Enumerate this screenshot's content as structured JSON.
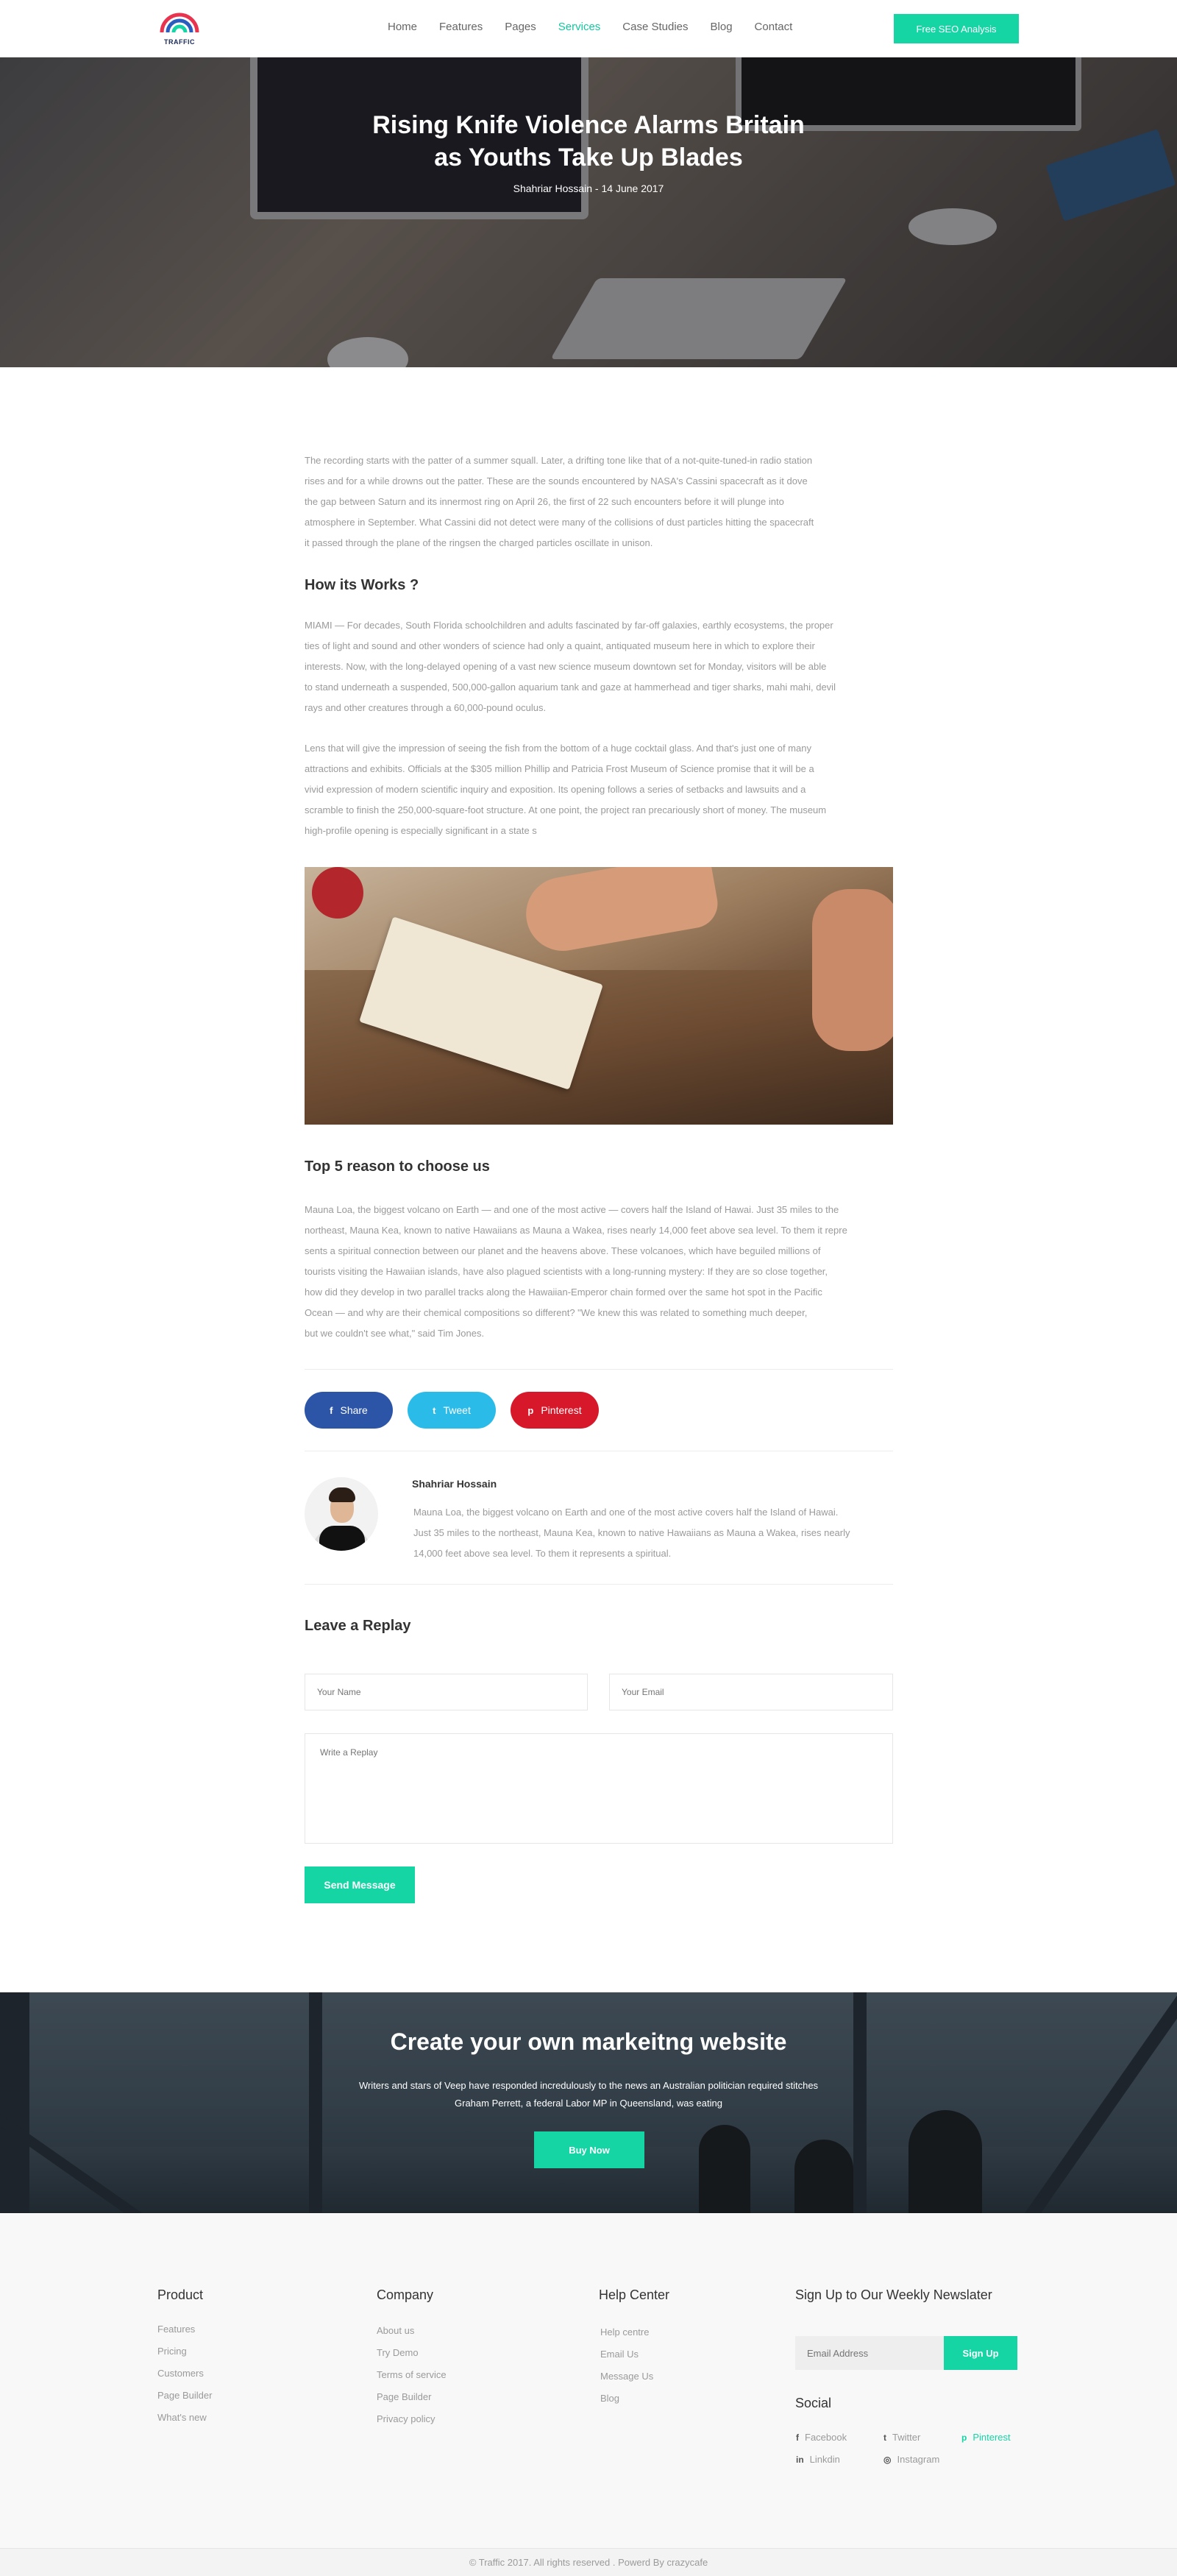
{
  "header": {
    "logo_text": "TRAFFIC",
    "nav": [
      "Home",
      "Features",
      "Pages",
      "Services",
      "Case Studies",
      "Blog",
      "Contact"
    ],
    "active_nav": "Services",
    "cta": "Free SEO Analysis"
  },
  "hero": {
    "title_line1": "Rising Knife Violence Alarms Britain",
    "title_line2": "as Youths Take Up Blades",
    "meta": "Shahriar Hossain - 14 June 2017"
  },
  "article": {
    "intro": [
      "The recording starts with the patter of a summer squall. Later, a drifting tone like that of a not-quite-tuned-in radio station",
      "rises and for a while drowns out the patter. These are the sounds encountered by NASA's Cassini spacecraft as it dove",
      " the gap between Saturn and its innermost ring on April 26, the first of 22 such encounters before it will plunge into",
      "atmosphere in September. What Cassini did not detect were many of the collisions of dust particles hitting the spacecraft",
      "it passed through the plane of the ringsen the charged particles oscillate in unison."
    ],
    "heading1": "How its Works ?",
    "para2": [
      "MIAMI — For decades, South Florida schoolchildren and adults fascinated by far-off galaxies, earthly ecosystems, the proper",
      "ties of light and sound and other wonders of science had only a quaint, antiquated museum here in which to explore their",
      "interests. Now, with the long-delayed opening of a vast new science museum downtown set for Monday, visitors will be able",
      "to stand underneath a suspended, 500,000-gallon aquarium tank and gaze at hammerhead and tiger sharks, mahi mahi, devil",
      "rays and other creatures through a 60,000-pound oculus."
    ],
    "para3": [
      "Lens that will give the impression of seeing the fish from the bottom of a huge cocktail glass. And that's just one of many",
      " attractions and exhibits. Officials at the $305 million Phillip and Patricia Frost Museum of Science promise that it will be a",
      "vivid expression of modern scientific inquiry and exposition. Its opening follows a series of setbacks and lawsuits and a",
      "scramble to finish the 250,000-square-foot structure. At one point, the project ran precariously short of money. The museum",
      "high-profile opening is especially significant in a state s"
    ],
    "heading2": "Top 5 reason to choose us",
    "para4": [
      "Mauna Loa, the biggest volcano on Earth — and one of the most active — covers half the Island of Hawai. Just 35 miles to the",
      "northeast, Mauna Kea, known to native Hawaiians as Mauna a Wakea, rises nearly 14,000 feet above sea level. To them it repre",
      "sents a spiritual connection between our planet and the heavens above. These volcanoes, which have beguiled millions of",
      "tourists visiting the Hawaiian islands, have also plagued scientists with a long-running mystery: If they are so close together,",
      "how did they develop in two parallel tracks along the Hawaiian-Emperor chain formed over the same hot spot in the Pacific",
      "Ocean — and why are their chemical compositions so different? \"We knew this was related to something much deeper,",
      "but we couldn't see what,\" said Tim Jones."
    ]
  },
  "share": [
    {
      "label": "Share",
      "icon": "f",
      "color": "#2d55a7"
    },
    {
      "label": "Tweet",
      "icon": "t",
      "color": "#2bbbe8"
    },
    {
      "label": "Pinterest",
      "icon": "p",
      "color": "#d7182a"
    }
  ],
  "author": {
    "name": "Shahriar Hossain",
    "bio": [
      "Mauna Loa, the biggest volcano on Earth and one of the most active covers half the Island of Hawai.",
      "Just 35 miles to the northeast, Mauna Kea, known to native Hawaiians as Mauna a Wakea, rises nearly",
      "14,000 feet above sea level. To them it represents a spiritual."
    ]
  },
  "reply": {
    "title": "Leave a Replay",
    "name_placeholder": "Your Name",
    "email_placeholder": "Your Email",
    "message_placeholder": "Write a Replay",
    "submit": "Send Message"
  },
  "cta_band": {
    "title": "Create your own markeitng website",
    "text_line1": "Writers and stars of Veep have responded incredulously to the news an Australian politician required stitches",
    "text_line2": "Graham Perrett, a federal Labor MP in Queensland, was eating",
    "button": "Buy Now"
  },
  "footer": {
    "product": {
      "title": "Product",
      "links": [
        "Features",
        "Pricing",
        "Customers",
        "Page Builder",
        "What's new"
      ]
    },
    "company": {
      "title": "Company",
      "links": [
        "About us",
        "Try Demo",
        "Terms of service",
        "Page Builder",
        "Privacy policy"
      ]
    },
    "help": {
      "title": "Help Center",
      "links": [
        "Help centre",
        "Email Us",
        "Message Us",
        "Blog"
      ]
    },
    "newsletter": {
      "title": "Sign Up to Our Weekly Newslater",
      "placeholder": "Email Address",
      "button": "Sign Up"
    },
    "social": {
      "title": "Social",
      "links": [
        {
          "label": "Facebook",
          "icon": "f"
        },
        {
          "label": "Twitter",
          "icon": "t"
        },
        {
          "label": "Pinterest",
          "icon": "p"
        },
        {
          "label": "Linkdin",
          "icon": "in"
        },
        {
          "label": "Instagram",
          "icon": "◎"
        }
      ]
    },
    "copyright": "© Traffic 2017. All rights reserved . Powerd By crazycafe"
  },
  "colors": {
    "accent": "#16d5a4",
    "facebook": "#2d55a7",
    "twitter": "#2bbbe8",
    "pinterest": "#d7182a"
  }
}
